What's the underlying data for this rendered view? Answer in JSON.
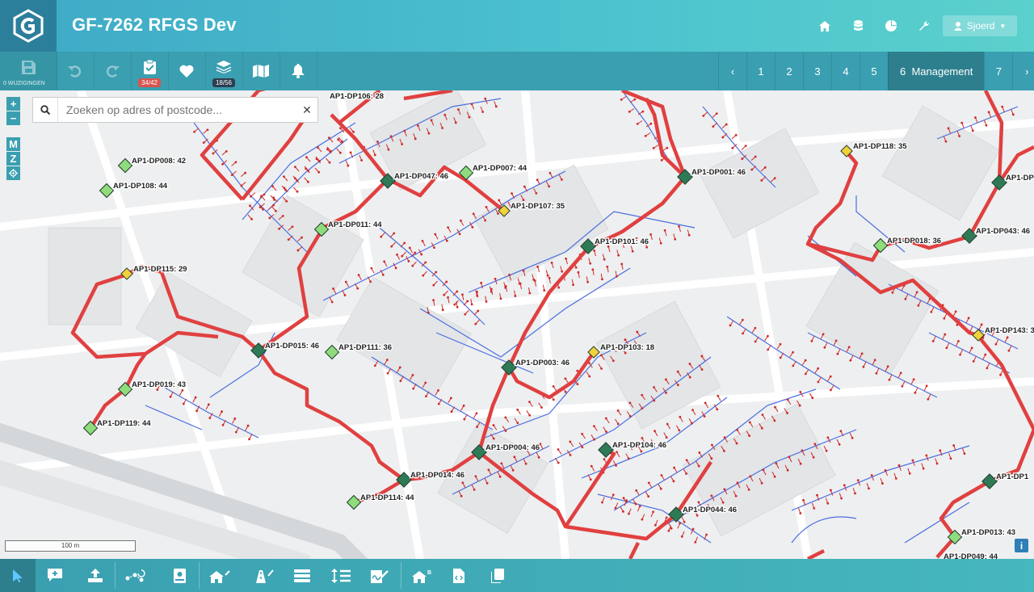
{
  "header": {
    "title": "GF-7262 RFGS Dev",
    "user_name": "Sjoerd",
    "icons": [
      "home-icon",
      "database-icon",
      "pie-chart-icon",
      "wrench-icon",
      "user-icon"
    ]
  },
  "toolbar": {
    "save_label": "0 WIJZIGINGEN",
    "tasks_badge": "34/42",
    "layers_badge": "18/56"
  },
  "pager": {
    "pages": [
      "1",
      "2",
      "3",
      "4",
      "5"
    ],
    "active": "6  Management",
    "next_page": "7"
  },
  "map": {
    "search_placeholder": "Zoeken op adres of postcode...",
    "zoom_in": "+",
    "zoom_out": "−",
    "btn_m": "M",
    "btn_z": "Z",
    "scale_label": "100 m",
    "info": "i",
    "colors": {
      "trench": "#e04040",
      "cable": "#4a6fe0",
      "drop": "#d02a2a",
      "dp_dark": "#2f7a56",
      "dp_light": "#8fdc7c",
      "dp_yellow": "#f2d23a"
    },
    "distribution_points": [
      {
        "label": "AP1-DP106: 28",
        "status": "dark"
      },
      {
        "label": "AP1-DP008: 42",
        "status": "light"
      },
      {
        "label": "AP1-DP108: 44",
        "status": "light"
      },
      {
        "label": "AP1-DP047: 46",
        "status": "dark"
      },
      {
        "label": "AP1-DP007: 44",
        "status": "light"
      },
      {
        "label": "AP1-DP107: 35",
        "status": "yellow"
      },
      {
        "label": "AP1-DP001: 46",
        "status": "dark"
      },
      {
        "label": "AP1-DP118: 35",
        "status": "yellow"
      },
      {
        "label": "AP1-DP011: 44",
        "status": "light"
      },
      {
        "label": "AP1-DP101: 46",
        "status": "dark"
      },
      {
        "label": "AP1-DP018: 36",
        "status": "light"
      },
      {
        "label": "AP1-DP043: 46",
        "status": "dark"
      },
      {
        "label": "AP1-DP115: 29",
        "status": "yellow"
      },
      {
        "label": "AP1-DP143: 3",
        "status": "yellow"
      },
      {
        "label": "AP1-DP015: 46",
        "status": "dark"
      },
      {
        "label": "AP1-DP111: 36",
        "status": "light"
      },
      {
        "label": "AP1-DP103: 18",
        "status": "yellow"
      },
      {
        "label": "AP1-DP003: 46",
        "status": "dark"
      },
      {
        "label": "AP1-DP019: 43",
        "status": "light"
      },
      {
        "label": "AP1-DP119: 44",
        "status": "light"
      },
      {
        "label": "AP1-DP004: 46",
        "status": "dark"
      },
      {
        "label": "AP1-DP104: 46",
        "status": "dark"
      },
      {
        "label": "AP1-DP014: 46",
        "status": "dark"
      },
      {
        "label": "AP1-DP114: 44",
        "status": "light"
      },
      {
        "label": "AP1-DP044: 46",
        "status": "dark"
      },
      {
        "label": "AP1-DP013: 43",
        "status": "light"
      },
      {
        "label": "AP1-DP049: 44",
        "status": "light"
      },
      {
        "label": "AP1-DP",
        "status": "dark"
      },
      {
        "label": "AP1-DP1",
        "status": "dark"
      }
    ]
  },
  "bottom_toolbar": {
    "icons": [
      "pointer-icon",
      "add-comment-icon",
      "upload-icon",
      "network-refresh-icon",
      "book-icon",
      "house-edit-icon",
      "road-edit-icon",
      "rows-icon",
      "line-spacing-icon",
      "signature-icon",
      "house-plan-icon",
      "code-file-icon",
      "copy-icon"
    ]
  }
}
